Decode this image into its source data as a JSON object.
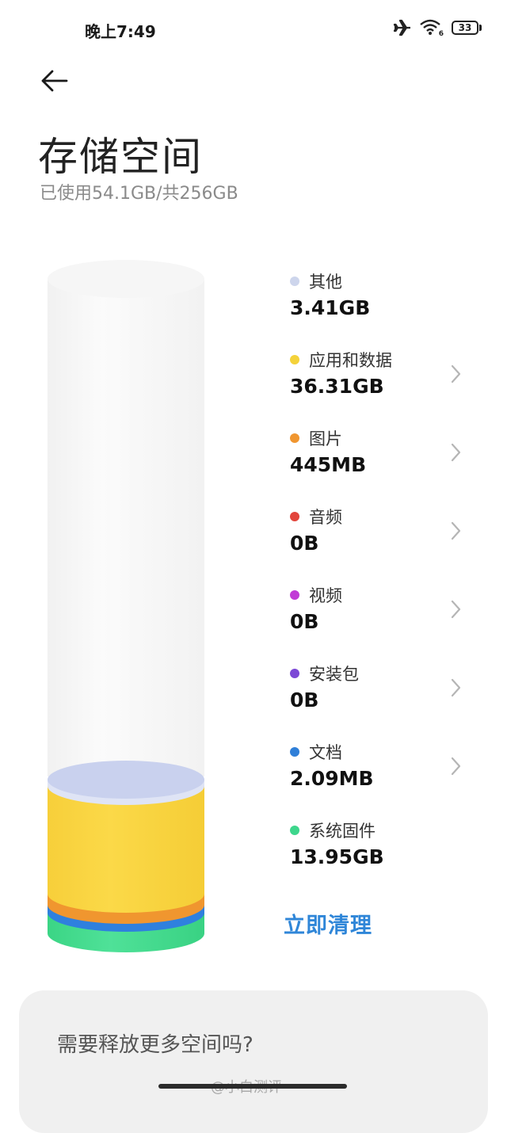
{
  "status_bar": {
    "time": "晚上7:49",
    "battery": "33",
    "wifi_badge": "6",
    "icons": [
      "airplane-icon",
      "wifi-icon",
      "battery-icon"
    ]
  },
  "header": {
    "back_icon": "arrow-left-icon",
    "title": "存储空间",
    "subtitle": "已使用54.1GB/共256GB"
  },
  "storage": {
    "used_gb": 54.1,
    "total_gb": 256,
    "categories": [
      {
        "name": "其他",
        "size": "3.41GB",
        "color": "#cdd5ec",
        "chevron": false
      },
      {
        "name": "应用和数据",
        "size": "36.31GB",
        "color": "#f4d23a",
        "chevron": true
      },
      {
        "name": "图片",
        "size": "445MB",
        "color": "#f0962f",
        "chevron": true
      },
      {
        "name": "音频",
        "size": "0B",
        "color": "#e2453c",
        "chevron": true
      },
      {
        "name": "视频",
        "size": "0B",
        "color": "#c13ad6",
        "chevron": true
      },
      {
        "name": "安装包",
        "size": "0B",
        "color": "#7c48d6",
        "chevron": true
      },
      {
        "name": "文档",
        "size": "2.09MB",
        "color": "#2f7fd8",
        "chevron": true
      },
      {
        "name": "系统固件",
        "size": "13.95GB",
        "color": "#3dd68c",
        "chevron": false
      }
    ]
  },
  "actions": {
    "clean_label": "立即清理"
  },
  "free_card": {
    "title": "需要释放更多空间吗?"
  },
  "watermark": "@小白测评",
  "colors": {
    "accent": "#2f86d8",
    "cylinder_body": "#f7f7f7",
    "yellow": "#f9d44a",
    "orange": "#f0962f",
    "blue": "#2f80de",
    "green": "#3fd98a",
    "other": "#cbd3ee"
  }
}
